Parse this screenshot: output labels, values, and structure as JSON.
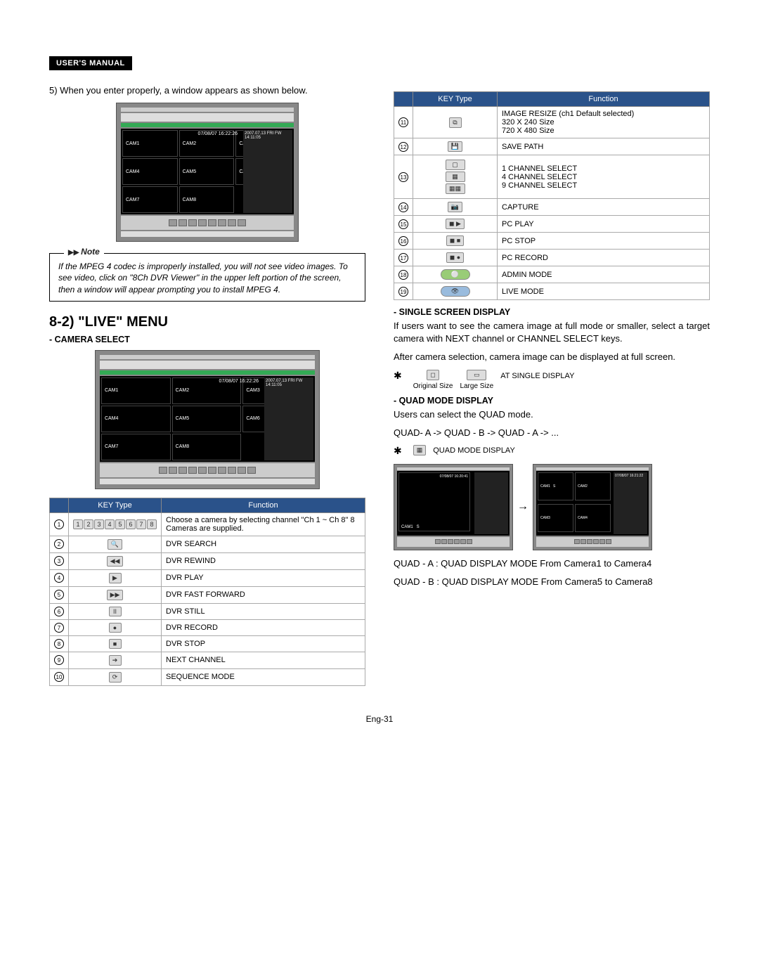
{
  "header": {
    "label": "USER'S MANUAL"
  },
  "intro_text": "5) When you enter properly, a window appears as shown below.",
  "screenshot": {
    "timestamp": "07/08/07   16:22:26",
    "side_time": "2007.07.13 FRI\nFW 14:11:05",
    "cams": [
      "CAM1",
      "CAM2",
      "CAM3",
      "CAM4",
      "CAM5",
      "CAM6",
      "CAM7",
      "CAM8"
    ]
  },
  "note": {
    "label": "Note",
    "text": "If the MPEG 4 codec is improperly installed, you will not see video images. To see video, click on \"8Ch DVR Viewer\" in the upper left portion of the screen, then a window will appear prompting you to install MPEG 4."
  },
  "section_title": "8-2) \"LIVE\" MENU",
  "sub_camera_select": "CAMERA SELECT",
  "table_headers": {
    "key": "KEY Type",
    "func": "Function"
  },
  "table_left": [
    {
      "n": "1",
      "icon": "chrow",
      "func": "Choose a camera by selecting channel \"Ch 1 ~ Ch 8\" 8 Cameras are supplied."
    },
    {
      "n": "2",
      "icon": "🔍",
      "func": "DVR SEARCH"
    },
    {
      "n": "3",
      "icon": "◀◀",
      "func": "DVR REWIND"
    },
    {
      "n": "4",
      "icon": "▶",
      "func": "DVR PLAY"
    },
    {
      "n": "5",
      "icon": "▶▶",
      "func": "DVR FAST FORWARD"
    },
    {
      "n": "6",
      "icon": "II",
      "func": "DVR STILL"
    },
    {
      "n": "7",
      "icon": "●",
      "func": "DVR RECORD"
    },
    {
      "n": "8",
      "icon": "■",
      "func": "DVR STOP"
    },
    {
      "n": "9",
      "icon": "➔",
      "func": "NEXT CHANNEL"
    },
    {
      "n": "10",
      "icon": "⟳",
      "func": "SEQUENCE MODE"
    }
  ],
  "table_right": [
    {
      "n": "11",
      "icon": "⧉",
      "func": "IMAGE RESIZE (ch1 Default selected)\n320 X 240 Size\n720 X 480 Size"
    },
    {
      "n": "12",
      "icon": "💾",
      "func": "SAVE PATH"
    },
    {
      "n": "13",
      "icon": "stack3",
      "func": "1 CHANNEL SELECT\n4 CHANNEL SELECT\n9 CHANNEL SELECT"
    },
    {
      "n": "14",
      "icon": "📷",
      "func": "CAPTURE"
    },
    {
      "n": "15",
      "icon": "◼ ▶",
      "func": "PC PLAY"
    },
    {
      "n": "16",
      "icon": "◼ ■",
      "func": "PC STOP"
    },
    {
      "n": "17",
      "icon": "◼ ●",
      "func": "PC RECORD"
    },
    {
      "n": "18",
      "icon": "oval-green",
      "func": "ADMIN MODE"
    },
    {
      "n": "19",
      "icon": "oval-blue",
      "func": "LIVE MODE"
    }
  ],
  "single": {
    "heading": "SINGLE SCREEN DISPLAY",
    "p1": "If users want to see the camera image at full mode or smaller, select a target camera with NEXT channel or CHANNEL SELECT keys.",
    "p2": "After camera selection, camera image can be displayed at full screen.",
    "label_orig": "Original Size",
    "label_large": "Large Size",
    "label_text": "AT SINGLE DISPLAY"
  },
  "quad": {
    "heading": "QUAD MODE DISPLAY",
    "p1": "Users can select the QUAD mode.",
    "p2": "QUAD- A -> QUAD - B -> QUAD - A -> ...",
    "label_icon": "QUAD MODE DISPLAY",
    "quad_a_time": "07/08/07   16:20:41",
    "quad_b_time": "07/08/07   16:21:22",
    "desc_a": "QUAD - A : QUAD DISPLAY MODE From Camera1 to Camera4",
    "desc_b": "QUAD - B : QUAD DISPLAY MODE From Camera5 to Camera8"
  },
  "page_number": "Eng-31"
}
